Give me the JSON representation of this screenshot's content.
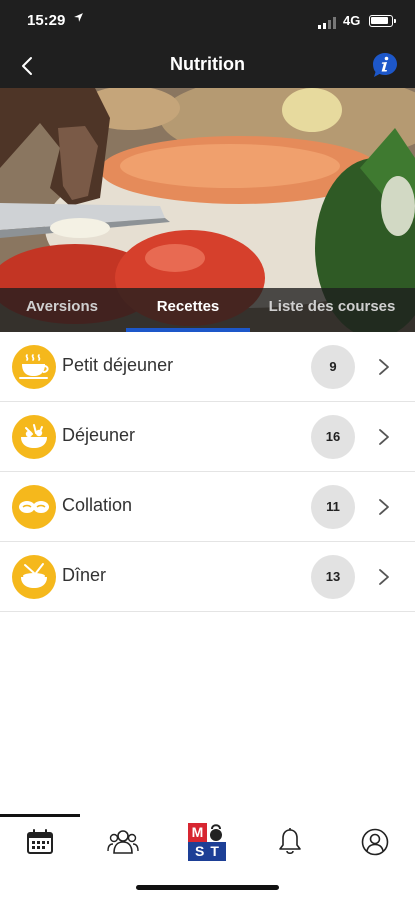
{
  "status_bar": {
    "time": "15:29",
    "location_icon": "location-arrow-icon",
    "network": "4G",
    "battery_level": 0.9
  },
  "nav": {
    "title": "Nutrition",
    "back_icon": "chevron-left-icon",
    "info_icon": "info-icon"
  },
  "tabs": [
    {
      "label": "Aversions",
      "active": false
    },
    {
      "label": "Recettes",
      "active": true
    },
    {
      "label": "Liste des courses",
      "active": false
    }
  ],
  "meals": [
    {
      "label": "Petit déjeuner",
      "count": "9",
      "icon": "coffee-cup-icon"
    },
    {
      "label": "Déjeuner",
      "count": "16",
      "icon": "salad-bowl-icon"
    },
    {
      "label": "Collation",
      "count": "11",
      "icon": "snack-icon"
    },
    {
      "label": "Dîner",
      "count": "13",
      "icon": "dinner-bowl-icon"
    }
  ],
  "bottom_nav": {
    "items": [
      "calendar-icon",
      "group-icon",
      "mst-logo",
      "bell-icon",
      "profile-icon"
    ],
    "logo": {
      "top": "M",
      "bottom": "ST"
    },
    "active_index": 0
  },
  "colors": {
    "header_bg": "#1f1f1f",
    "accent_blue": "#1d57c9",
    "icon_yellow": "#f5b81c",
    "badge_grey": "#e2e2e2"
  }
}
